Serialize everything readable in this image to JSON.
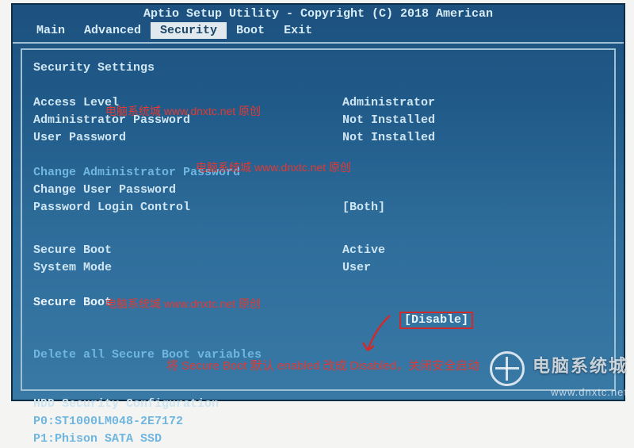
{
  "title": "Aptio Setup Utility - Copyright (C) 2018 American",
  "tabs": {
    "main": "Main",
    "advanced": "Advanced",
    "security": "Security",
    "boot": "Boot",
    "exit": "Exit"
  },
  "heading": "Security Settings",
  "rows": {
    "access_level": {
      "label": "Access Level",
      "value": "Administrator"
    },
    "admin_password": {
      "label": "Administrator Password",
      "value": "Not Installed"
    },
    "user_password": {
      "label": "User Password",
      "value": "Not Installed"
    },
    "change_admin_pw": {
      "label": "Change Administrator Password"
    },
    "change_user_pw": {
      "label": "Change User Password"
    },
    "pw_login_control": {
      "label": "Password Login Control",
      "value": "[Both]"
    },
    "secure_boot_status": {
      "label": "Secure Boot",
      "value": "Active"
    },
    "system_mode": {
      "label": "System Mode",
      "value": "User"
    },
    "secure_boot": {
      "label": "Secure Boot",
      "value": "[Disable]"
    },
    "delete_sb_vars": {
      "label": "Delete all Secure Boot variables"
    },
    "hdd_sec_cfg": {
      "label": "HDD Security Configuration"
    },
    "hdd0": {
      "label": "P0:ST1000LM048-2E7172"
    },
    "hdd1": {
      "label": "P1:Phison SATA SSD"
    }
  },
  "watermarks": {
    "w1": "电脑系统城 www.dnxtc.net 原创",
    "w2": "电脑系统城 www.dnxtc.net 原创",
    "w3": "电脑系统城 www.dnxtc.net 原创"
  },
  "annotation": "将 Secure Boot 默认 enabled 改成 Disabled，关闭安全启动",
  "site": {
    "cn": "电脑系统城",
    "url": "www.dnxtc.net"
  }
}
